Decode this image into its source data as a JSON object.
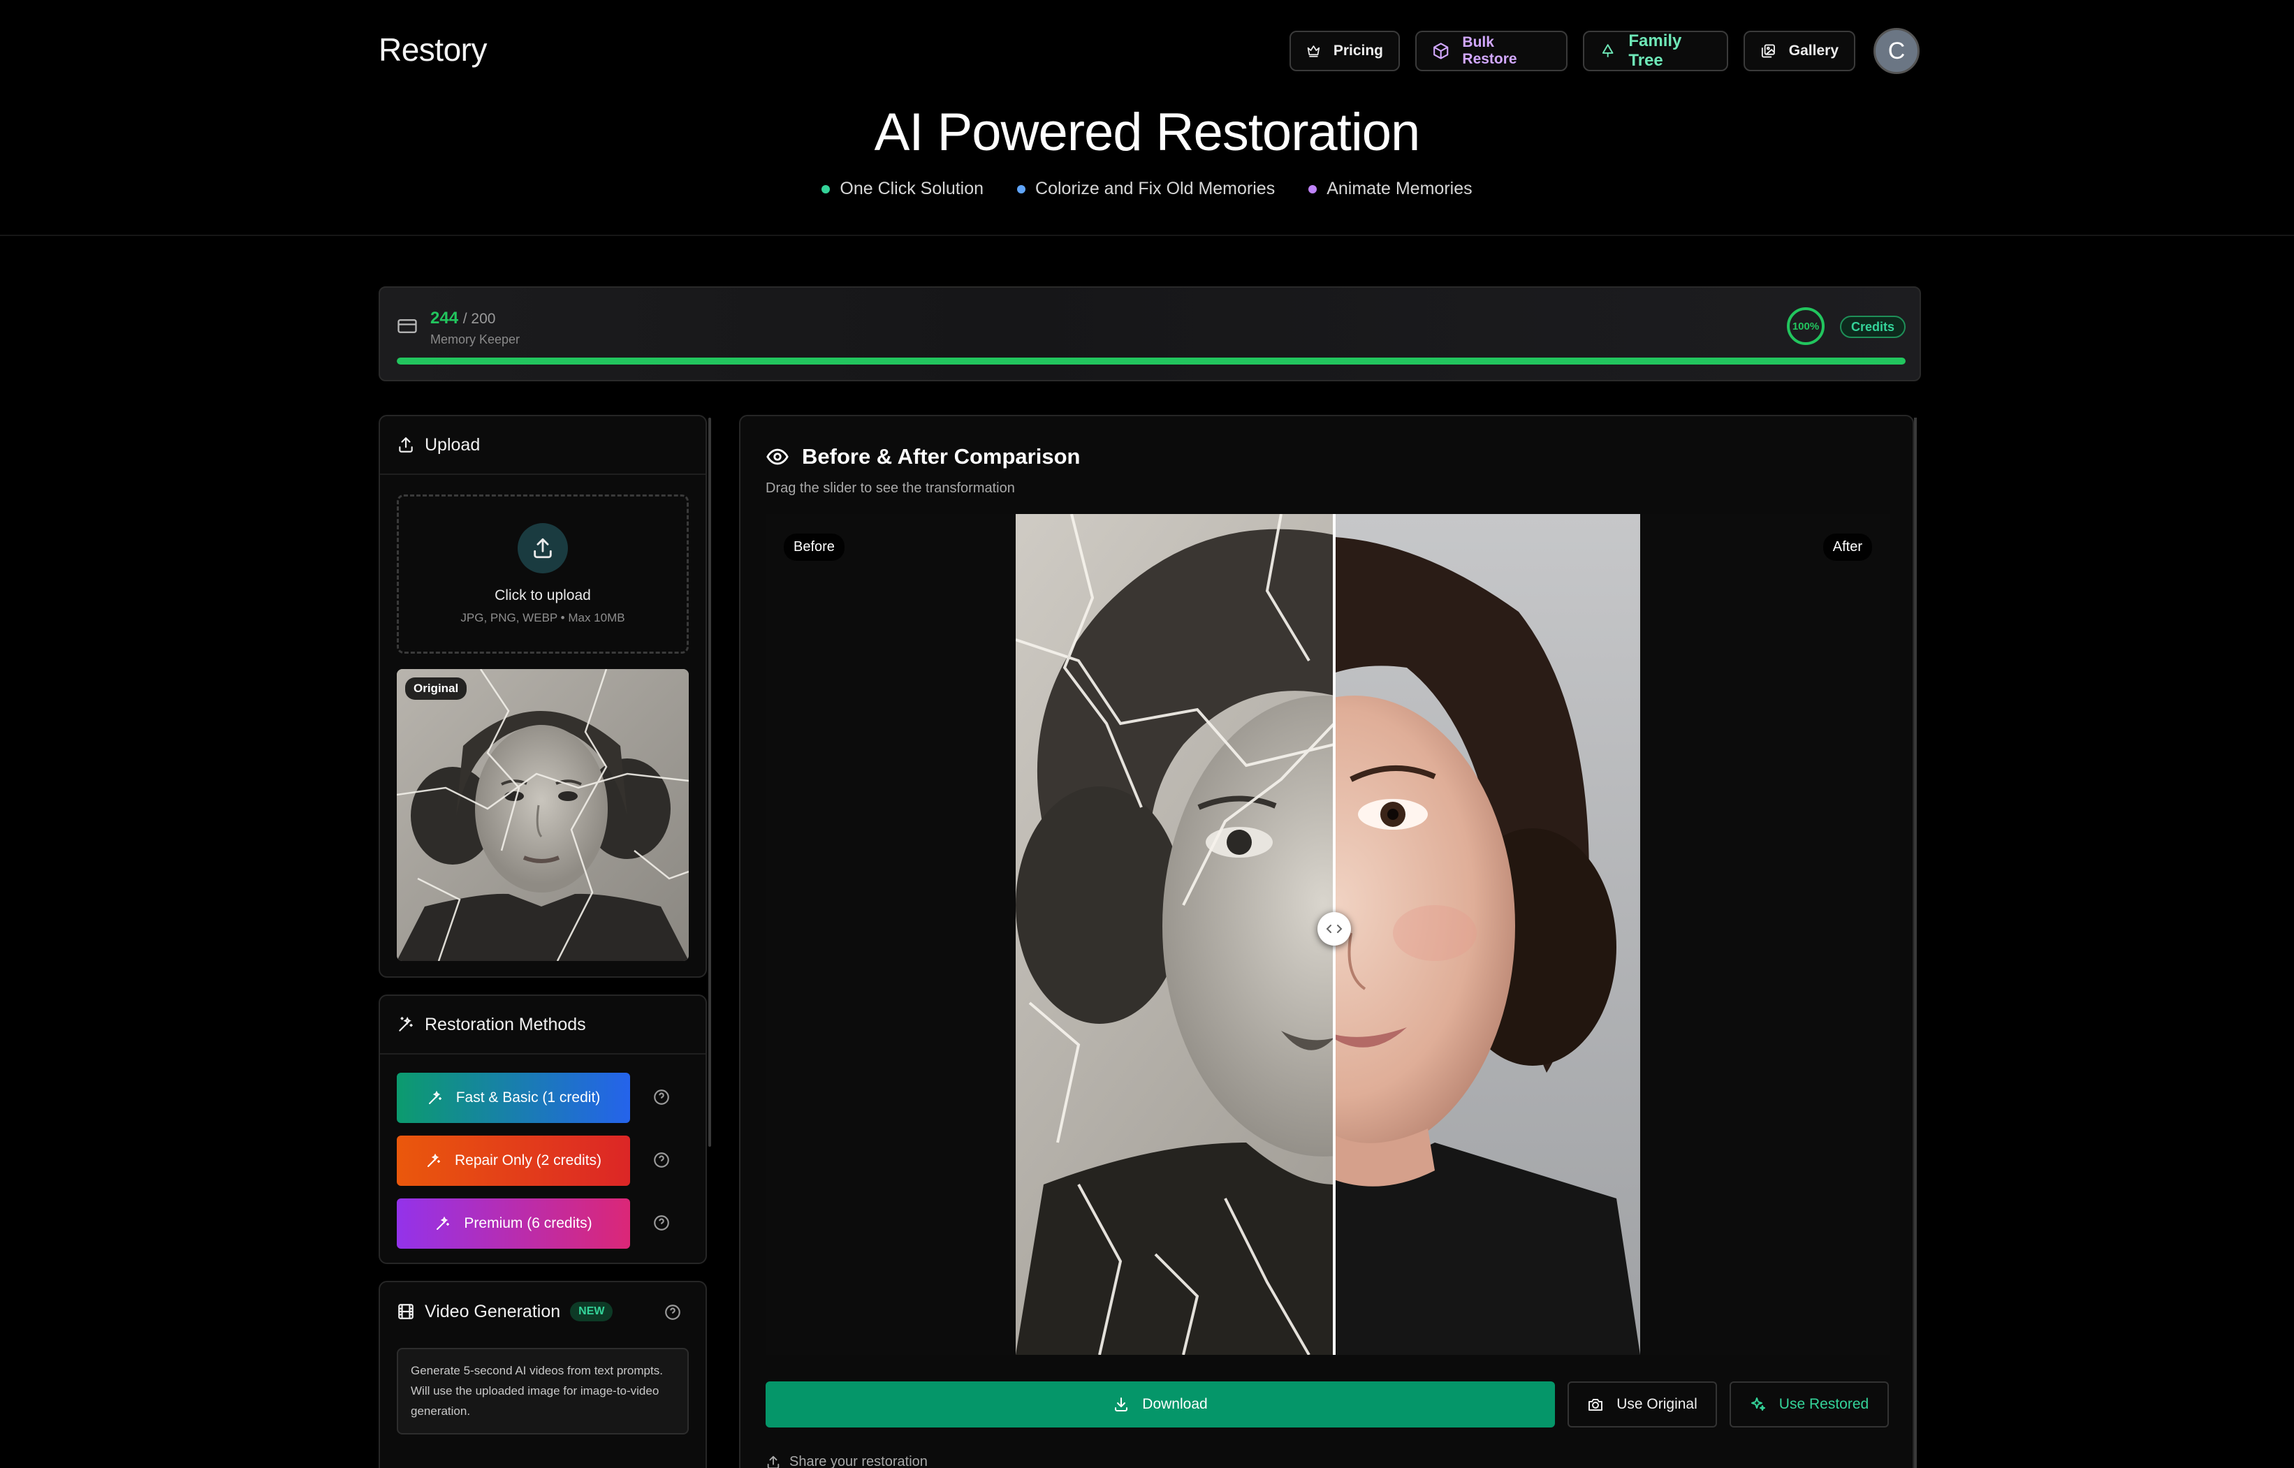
{
  "app": {
    "name": "Restory"
  },
  "nav": {
    "pricing": "Pricing",
    "bulk_restore": "Bulk Restore",
    "family_tree": "Family Tree",
    "gallery": "Gallery",
    "avatar_initial": "C"
  },
  "hero": {
    "title": "AI Powered Restoration",
    "features": [
      {
        "label": "One Click Solution",
        "color": "#34d399"
      },
      {
        "label": "Colorize and Fix Old Memories",
        "color": "#60a5fa"
      },
      {
        "label": "Animate Memories",
        "color": "#c084fc"
      }
    ]
  },
  "credits": {
    "count": "244",
    "total": "/ 200",
    "tier": "Memory Keeper",
    "percent_label": "100%",
    "progress_fraction": 1.0,
    "badge": "Credits",
    "accent": "#22c55e"
  },
  "upload": {
    "heading": "Upload",
    "click_text": "Click to upload",
    "formats": "JPG, PNG, WEBP • Max 10MB",
    "original_badge": "Original"
  },
  "methods": {
    "heading": "Restoration Methods",
    "items": [
      {
        "label": "Fast & Basic (1 credit)"
      },
      {
        "label": "Repair Only (2 credits)"
      },
      {
        "label": "Premium (6 credits)"
      }
    ]
  },
  "video": {
    "heading": "Video Generation",
    "badge": "NEW",
    "description": "Generate 5-second AI videos from text prompts. Will use the uploaded image for image-to-video generation."
  },
  "comparison": {
    "title": "Before & After Comparison",
    "subtitle": "Drag the slider to see the transformation",
    "before_label": "Before",
    "after_label": "After",
    "slider_fraction": 0.51
  },
  "actions": {
    "download": "Download",
    "use_original": "Use Original",
    "use_restored": "Use Restored",
    "share": "Share your restoration"
  }
}
